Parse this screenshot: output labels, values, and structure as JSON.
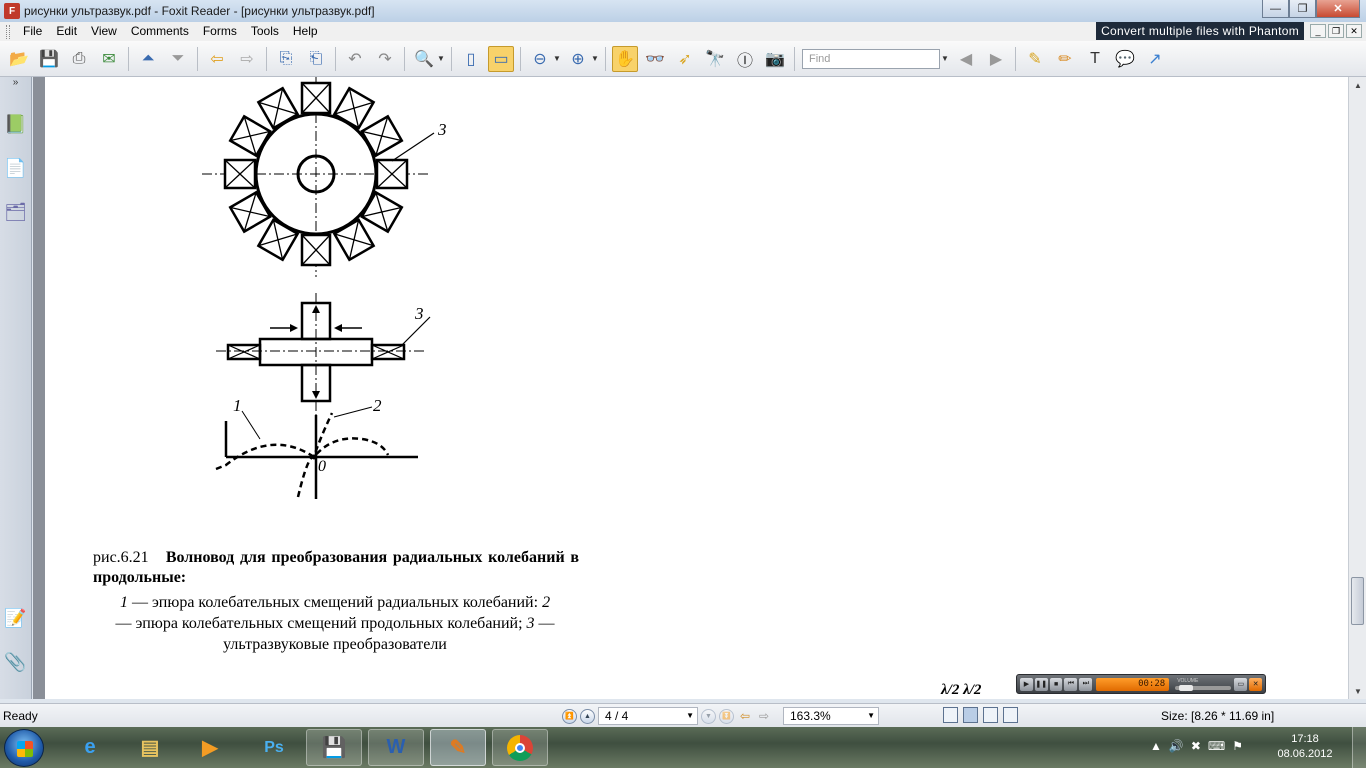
{
  "window": {
    "title": "рисунки ультразвук.pdf - Foxit Reader - [рисунки ультразвук.pdf]",
    "minimize": "—",
    "maximize": "❐",
    "close": "✕"
  },
  "menu": {
    "items": [
      "File",
      "Edit",
      "View",
      "Comments",
      "Forms",
      "Tools",
      "Help"
    ],
    "promo": "Convert multiple files with Phantom"
  },
  "toolbar": {
    "find_placeholder": "Find",
    "icons": [
      "open-icon",
      "save-icon",
      "print-icon",
      "email-icon",
      "page-up-icon",
      "page-down-icon",
      "back-icon",
      "forward-icon",
      "extract-icon",
      "extract2-icon",
      "undo-icon",
      "redo-icon",
      "zoom-in-icon",
      "fit-page-icon",
      "fit-width-icon",
      "zoom-out-icon",
      "zoom-plus-icon",
      "hand-icon",
      "glasses-icon",
      "select-icon",
      "find-icon",
      "text-select-icon",
      "snapshot-icon"
    ]
  },
  "figure": {
    "label_3_top": "3",
    "label_3_mid": "3",
    "label_1": "1",
    "label_2": "2",
    "label_0": "0"
  },
  "caption": {
    "lead": "рис.6.21",
    "title": "Волновод для преобразования радиальных колебаний в продольные:",
    "body_1_num": "1",
    "body_1": " — эпюра колебательных смещений радиальных колебаний: ",
    "body_2_num": "2",
    "body_2": " — эпюра колебательных смещений продольных колебаний; ",
    "body_3_num": "3",
    "body_3": " — ультразвуковые преобразователи"
  },
  "page_overflow_text": "λ/2  λ/2",
  "player": {
    "time": "00:28",
    "volume_label": "VOLUME"
  },
  "status": {
    "ready": "Ready",
    "page": "4 / 4",
    "zoom": "163.3%",
    "size": "Size: [8.26 * 11.69 in]"
  },
  "taskbar": {
    "apps": [
      "Internet Explorer",
      "Explorer",
      "Media Player",
      "Photoshop",
      "Save",
      "Word",
      "Foxit Reader",
      "Chrome"
    ],
    "time": "17:18",
    "date": "08.06.2012"
  }
}
